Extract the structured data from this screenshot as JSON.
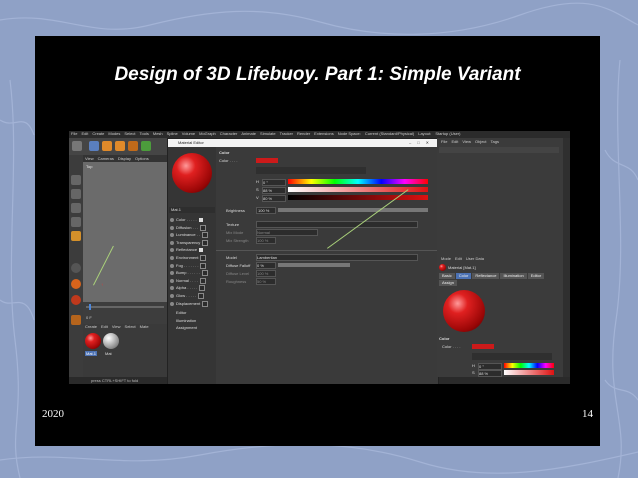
{
  "slide": {
    "title": "Design of 3D Lifebuoy. Part 1: Simple Variant",
    "footer_left": "2020",
    "footer_right": "14",
    "background_color": "#8fa1c6",
    "slide_color": "#000000"
  },
  "screenshot": {
    "menubar": [
      "File",
      "Edit",
      "Create",
      "Modes",
      "Select",
      "Tools",
      "Mesh",
      "Spline",
      "Volume",
      "MoGraph",
      "Character",
      "Animate",
      "Simulate",
      "Tracker",
      "Render",
      "Extensions",
      "Node Space:",
      "Current (Standard/Physical)",
      "Layout:",
      "Startup (User)"
    ],
    "viewport_menu": [
      "View",
      "Cameras",
      "Display",
      "Options"
    ],
    "viewport_label": "Top",
    "material_manager_menu": [
      "Create",
      "Edit",
      "View",
      "Select",
      "Mate"
    ],
    "material_names": [
      "Mat.1",
      "Mat"
    ],
    "status_text": "press CTRL+SHIFT to fold",
    "timeline_frame": "0 F",
    "dialog": {
      "title": "Material Editor",
      "material_name": "Mat.1",
      "channels": [
        {
          "label": "Color . . . . .",
          "checked": true
        },
        {
          "label": "Diffusion . . .",
          "checked": false
        },
        {
          "label": "Luminance . .",
          "checked": false
        },
        {
          "label": "Transparency",
          "checked": false
        },
        {
          "label": "Reflectance",
          "checked": true
        },
        {
          "label": "Environment",
          "checked": false
        },
        {
          "label": "Fog . . . . . . .",
          "checked": false
        },
        {
          "label": "Bump . . . . . .",
          "checked": false
        },
        {
          "label": "Normal . . . .",
          "checked": false
        },
        {
          "label": "Alpha . . . . .",
          "checked": false
        },
        {
          "label": "Glow . . . . .",
          "checked": false
        },
        {
          "label": "Displacement",
          "checked": false
        }
      ],
      "extra_items": [
        "Editor",
        "Illumination",
        "Assignment"
      ],
      "color_section": "Color",
      "color_label": "Color . . . .",
      "hsv": [
        {
          "k": "H",
          "v": "0 °"
        },
        {
          "k": "S",
          "v": "88 %"
        },
        {
          "k": "V",
          "v": "80 %"
        }
      ],
      "brightness_label": "Brightness",
      "brightness_value": "100 %",
      "texture_label": "Texture",
      "mix_mode_label": "Mix Mode",
      "mix_mode_value": "Normal",
      "mix_strength_label": "Mix Strength",
      "mix_strength_value": "100 %",
      "model_label": "Model",
      "model_value": "Lambertian",
      "diffuse_falloff_label": "Diffuse Falloff",
      "diffuse_falloff_value": "0 %",
      "diffuse_level_label": "Diffuse Level",
      "diffuse_level_value": "100 %",
      "roughness_label": "Roughness",
      "roughness_value": "50 %"
    },
    "right_panel": {
      "om_menu": [
        "File",
        "Edit",
        "View",
        "Object",
        "Tags"
      ],
      "am_menu": [
        "Mode",
        "Edit",
        "User Data"
      ],
      "material_title": "Material [Mat.1]",
      "tabs": [
        "Basic",
        "Color",
        "Reflectance",
        "Illumination",
        "Editor",
        "Assign"
      ],
      "color_section": "Color",
      "color_label": "Color . . . .",
      "hsv": [
        {
          "k": "H",
          "v": "0 °"
        },
        {
          "k": "S",
          "v": "88 %"
        }
      ],
      "side_tabs": [
        "Objects",
        "Takes",
        "Content Browser",
        "Attributes",
        "Layers",
        "Structure"
      ]
    },
    "accent_color": "#cc1a1a"
  }
}
